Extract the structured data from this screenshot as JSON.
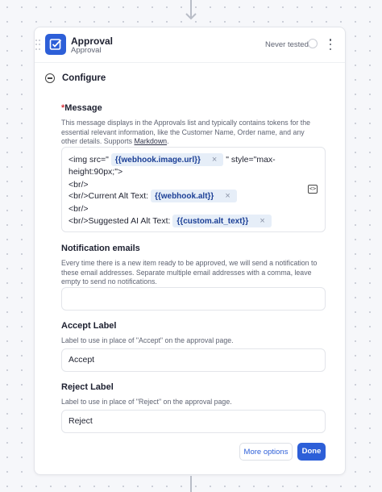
{
  "header": {
    "title": "Approval",
    "subtitle": "Approval",
    "status": "Never tested"
  },
  "configure": {
    "label": "Configure"
  },
  "message": {
    "label": "Message",
    "required_mark": "*",
    "help": "This message displays in the Approvals list and typically contains tokens for the essential relevant information, like the Customer Name, Order name, and any other details. Supports",
    "help_link": "Markdown",
    "help_end": ".",
    "lines": {
      "l1_prefix": "<img src=\"",
      "l1_token": "{{webhook.image.url}}",
      "l1_suffix": "\" style=\"max-",
      "l2": "height:90px;\">",
      "l3": "<br/>",
      "l4_prefix": "<br/>Current Alt Text:",
      "l4_token": "{{webhook.alt}}",
      "l5": "<br/>",
      "l6_prefix": "<br/>Suggested AI Alt Text:",
      "l6_token": "{{custom.alt_text}}"
    },
    "token_remove": "×",
    "code_icon": "<>"
  },
  "notification": {
    "label": "Notification emails",
    "help": "Every time there is a new item ready to be approved, we will send a notification to these email addresses. Separate multiple email addresses with a comma, leave empty to send no notifications.",
    "value": ""
  },
  "accept": {
    "label": "Accept Label",
    "help": "Label to use in place of \"Accept\" on the approval page.",
    "value": "Accept"
  },
  "reject": {
    "label": "Reject Label",
    "help": "Label to use in place of \"Reject\" on the approval page.",
    "value": "Reject"
  },
  "footer": {
    "more_options": "More options",
    "done": "Done"
  },
  "colors": {
    "accent": "#2d5fd8",
    "token_bg": "#e6eef8",
    "required": "#d6333c"
  }
}
